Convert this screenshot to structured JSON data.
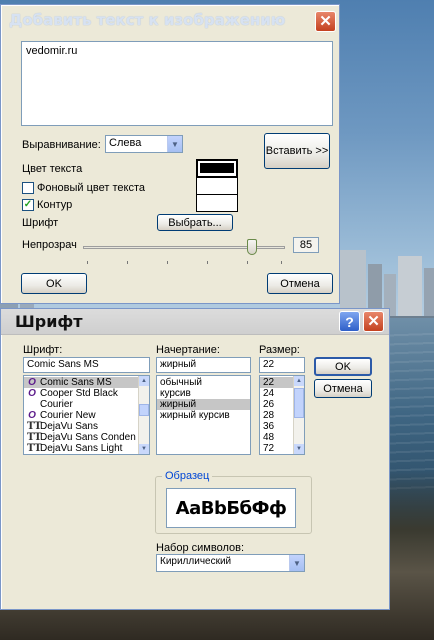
{
  "add_text_dialog": {
    "title": "Добавить текст к изображению",
    "close_glyph": "✕",
    "text_value": "vedomir.ru",
    "alignment_label": "Выравнивание:",
    "alignment_value": "Слева",
    "insert_button": "Вставить >>",
    "text_color_label": "Цвет текста",
    "bg_color_label": "Фоновый цвет текста",
    "bg_color_checked": false,
    "outline_label": "Контур",
    "outline_checked": true,
    "outline_check_glyph": "✓",
    "font_label": "Шрифт",
    "choose_button": "Выбрать...",
    "opacity_label": "Непрозрач",
    "opacity_value": "85",
    "ok_button": "OK",
    "cancel_button": "Отмена",
    "colors": {
      "text_color": "#000000",
      "bg_color": "#ffffff",
      "outline_color": "#ffffff"
    }
  },
  "font_dialog": {
    "title": "Шрифт",
    "help_glyph": "?",
    "close_glyph": "✕",
    "font_label": "Шрифт:",
    "font_value": "Comic Sans MS",
    "fonts": [
      {
        "name": "Comic Sans MS",
        "icon": "O",
        "selected": true
      },
      {
        "name": "Cooper Std Black",
        "icon": "O",
        "selected": false
      },
      {
        "name": "Courier",
        "icon": "",
        "selected": false
      },
      {
        "name": "Courier New",
        "icon": "O",
        "selected": false
      },
      {
        "name": "DejaVu Sans",
        "icon": "TT",
        "selected": false
      },
      {
        "name": "DejaVu Sans Conden",
        "icon": "TT",
        "selected": false
      },
      {
        "name": "DejaVu Sans Light",
        "icon": "TT",
        "selected": false
      }
    ],
    "style_label": "Начертание:",
    "style_value": "жирный",
    "styles": [
      {
        "name": "обычный",
        "selected": false
      },
      {
        "name": "курсив",
        "selected": false
      },
      {
        "name": "жирный",
        "selected": true
      },
      {
        "name": "жирный курсив",
        "selected": false
      }
    ],
    "size_label": "Размер:",
    "size_value": "22",
    "sizes": [
      {
        "name": "22",
        "selected": true
      },
      {
        "name": "24",
        "selected": false
      },
      {
        "name": "26",
        "selected": false
      },
      {
        "name": "28",
        "selected": false
      },
      {
        "name": "36",
        "selected": false
      },
      {
        "name": "48",
        "selected": false
      },
      {
        "name": "72",
        "selected": false
      }
    ],
    "ok_button": "OK",
    "cancel_button": "Отмена",
    "sample_label": "Образец",
    "sample_text": "AaBbБбФф",
    "charset_label": "Набор символов:",
    "charset_value": "Кириллический"
  },
  "icons": {
    "combo_arrow": "▼",
    "scroll_up": "▲",
    "scroll_down": "▼"
  }
}
